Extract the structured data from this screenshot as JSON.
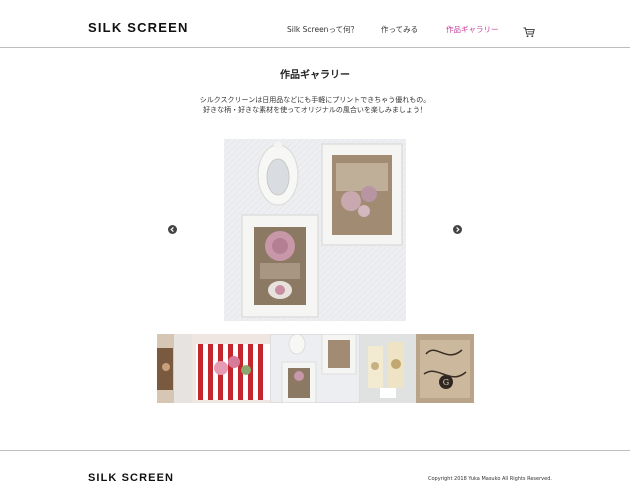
{
  "header": {
    "logo": "SILK SCREEN",
    "nav": [
      {
        "label": "Silk Screenって何？"
      },
      {
        "label": "作ってみる"
      },
      {
        "label": "作品ギャラリー"
      }
    ],
    "cart_icon": "cart-icon"
  },
  "main": {
    "title": "作品ギャラリー",
    "intro_line1": "シルクスクリーンは日用品などにも手軽にプリントできちゃう優れもの。",
    "intro_line2": "好きな柄・好きな素材を使ってオリジナルの風合いを楽しみましょう！",
    "prev_icon": "arrow-left-icon",
    "next_icon": "arrow-right-icon"
  },
  "footer": {
    "logo": "SILK SCREEN",
    "copyright": "Copyright 2018 Yuka Masuko All Rights Reserved."
  },
  "colors": {
    "accent": "#c2399a",
    "divider": "#bdbdbd",
    "arrow": "#444444"
  }
}
